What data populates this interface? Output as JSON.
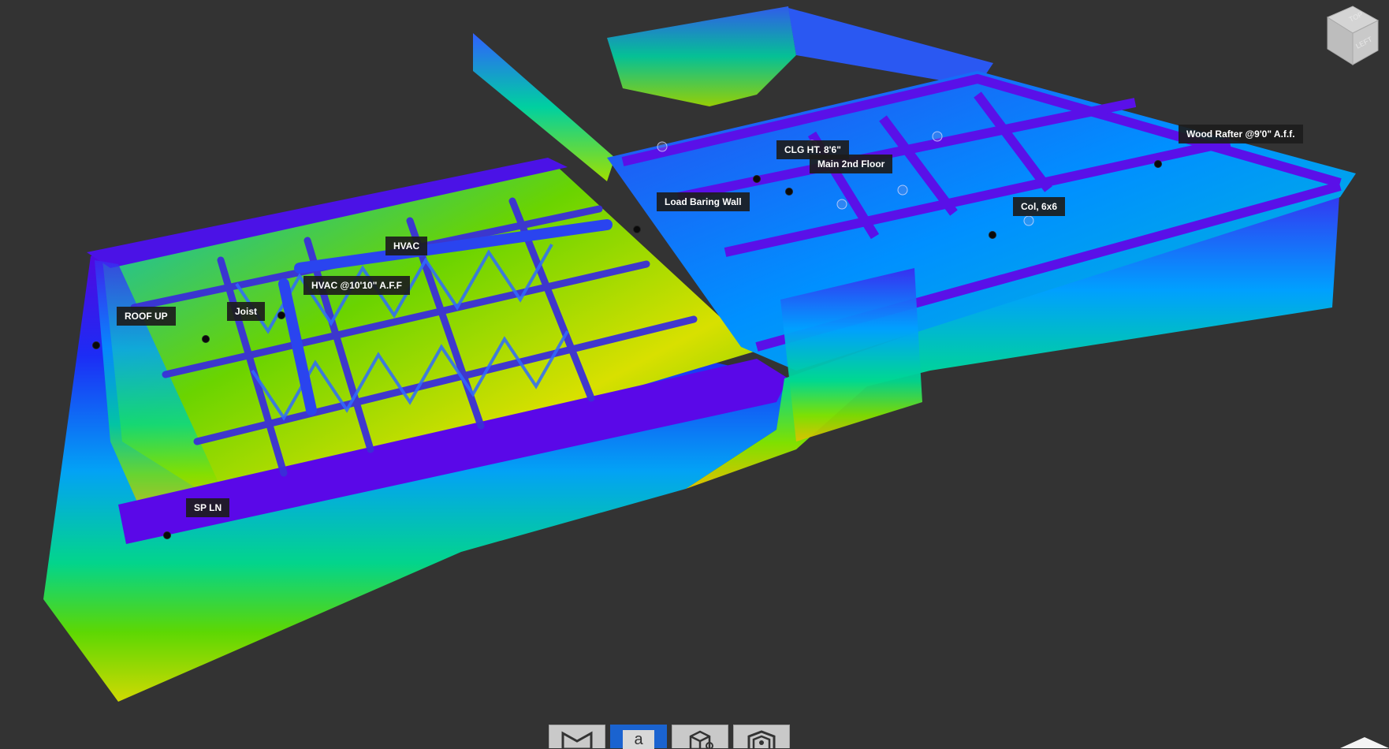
{
  "viewer": {
    "background": "#333333",
    "colormap": [
      "#1500b8",
      "#4a00e0",
      "#0030ff",
      "#00a0ff",
      "#00e0a0",
      "#40e000",
      "#c0e000",
      "#e8e000"
    ]
  },
  "annotations": [
    {
      "id": "roof-up",
      "label": "ROOF UP"
    },
    {
      "id": "joist",
      "label": "Joist"
    },
    {
      "id": "hvac",
      "label": "HVAC"
    },
    {
      "id": "hvac-10-10",
      "label": "HVAC @10'10\" A.F.F"
    },
    {
      "id": "sp-ln",
      "label": "SP LN"
    },
    {
      "id": "load-baring-wall",
      "label": "Load Baring Wall"
    },
    {
      "id": "clg-ht",
      "label": "CLG HT. 8'6\""
    },
    {
      "id": "main-2nd-floor",
      "label": "Main 2nd Floor"
    },
    {
      "id": "col-6x6",
      "label": "Col, 6x6"
    },
    {
      "id": "wood-rafter",
      "label": "Wood Rafter @9'0\" A.f.f."
    }
  ],
  "view_cube": {
    "faces": [
      "TOP",
      "LEFT"
    ],
    "icon": "view-cube-icon"
  },
  "toolbar": {
    "buttons": [
      {
        "id": "measure",
        "icon": "tape-measure-icon",
        "active": false
      },
      {
        "id": "annotate",
        "icon": "annotation-icon",
        "glyph": "a",
        "active": true
      },
      {
        "id": "model",
        "icon": "3d-box-icon",
        "active": false
      },
      {
        "id": "section",
        "icon": "section-box-icon",
        "active": false
      }
    ]
  },
  "navigation": {
    "icon": "expand-up-icon"
  }
}
